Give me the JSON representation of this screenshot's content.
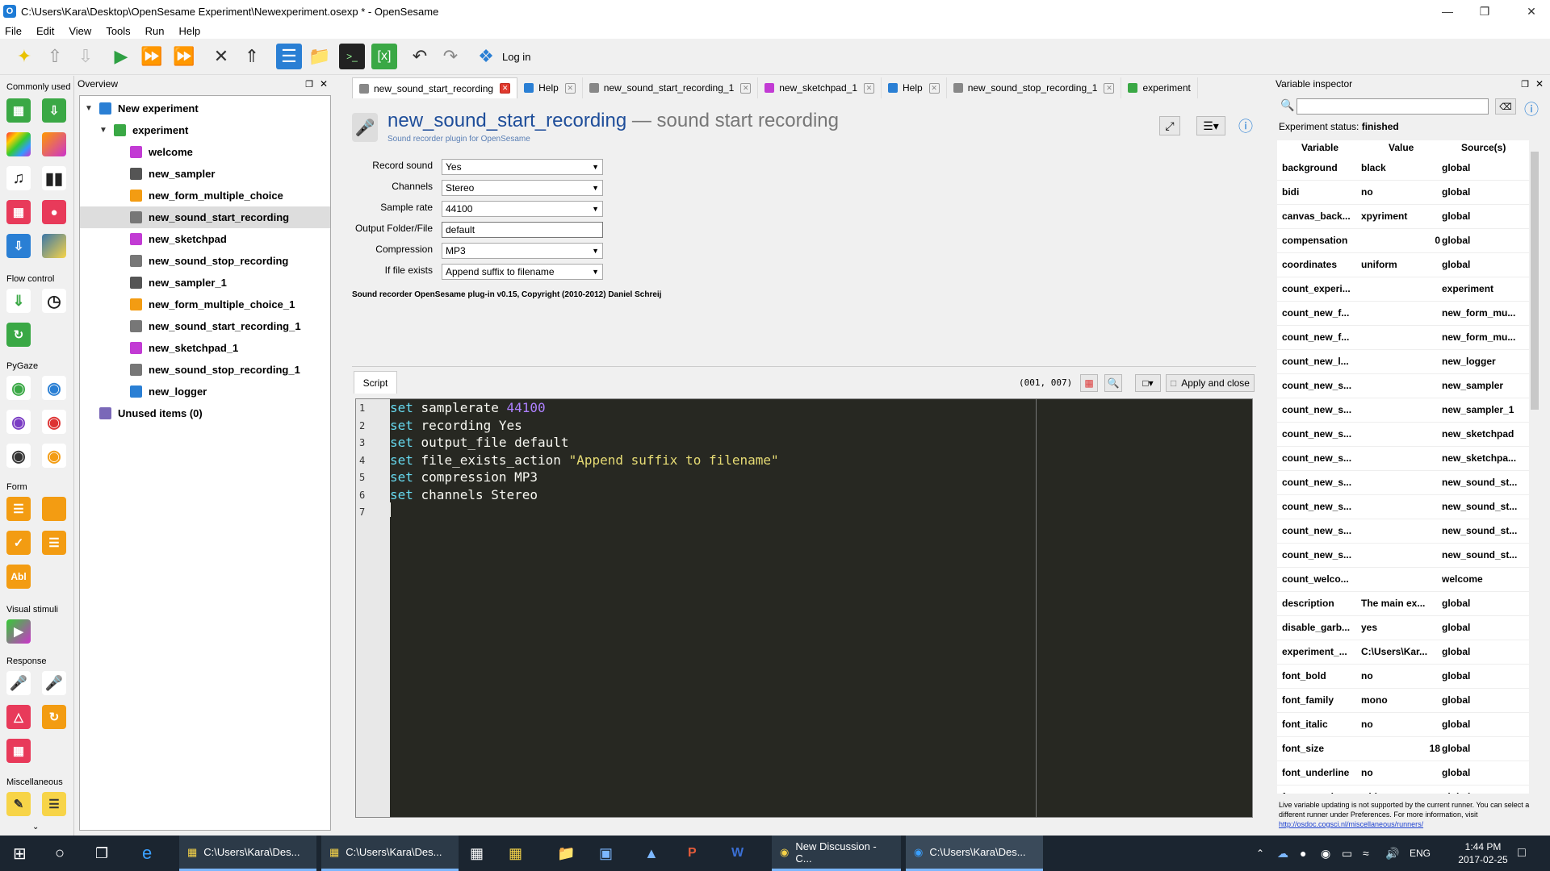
{
  "window": {
    "title": "C:\\Users\\Kara\\Desktop\\OpenSesame Experiment\\Newexperiment.osexp * - OpenSesame",
    "app_icon_letter": "O"
  },
  "menu": [
    "File",
    "Edit",
    "View",
    "Tools",
    "Run",
    "Help"
  ],
  "toolbar": {
    "login_label": "Log in"
  },
  "palette": {
    "sections": [
      "Commonly used",
      "Flow control",
      "PyGaze",
      "Form",
      "Visual stimuli",
      "Response",
      "Miscellaneous"
    ],
    "form_text_icon": "Abl"
  },
  "overview": {
    "title": "Overview",
    "root": "New experiment",
    "sequence": "experiment",
    "items": [
      {
        "name": "welcome",
        "color": "#c23bd4"
      },
      {
        "name": "new_sampler",
        "color": "#555555"
      },
      {
        "name": "new_form_multiple_choice",
        "color": "#f39c12"
      },
      {
        "name": "new_sound_start_recording",
        "color": "#777777"
      },
      {
        "name": "new_sketchpad",
        "color": "#c23bd4"
      },
      {
        "name": "new_sound_stop_recording",
        "color": "#777777"
      },
      {
        "name": "new_sampler_1",
        "color": "#555555"
      },
      {
        "name": "new_form_multiple_choice_1",
        "color": "#f39c12"
      },
      {
        "name": "new_sound_start_recording_1",
        "color": "#777777"
      },
      {
        "name": "new_sketchpad_1",
        "color": "#c23bd4"
      },
      {
        "name": "new_sound_stop_recording_1",
        "color": "#777777"
      },
      {
        "name": "new_logger",
        "color": "#2a7fd4"
      }
    ],
    "unused": "Unused items (0)"
  },
  "tabs": [
    {
      "label": "new_sound_start_recording",
      "active": true
    },
    {
      "label": "Help"
    },
    {
      "label": "new_sound_start_recording_1"
    },
    {
      "label": "new_sketchpad_1"
    },
    {
      "label": "Help"
    },
    {
      "label": "new_sound_stop_recording_1"
    },
    {
      "label": "experiment"
    }
  ],
  "item": {
    "name": "new_sound_start_recording",
    "type": "— sound start recording",
    "description": "Sound recorder plugin for OpenSesame"
  },
  "form": {
    "record_sound": {
      "label": "Record sound",
      "value": "Yes"
    },
    "channels": {
      "label": "Channels",
      "value": "Stereo"
    },
    "sample_rate": {
      "label": "Sample rate",
      "value": "44100"
    },
    "output": {
      "label": "Output Folder/File",
      "value": "default"
    },
    "compression": {
      "label": "Compression",
      "value": "MP3"
    },
    "if_exists": {
      "label": "If file exists",
      "value": "Append suffix to filename"
    }
  },
  "plugin_copyright": "Sound recorder OpenSesame plug-in v0.15, Copyright (2010-2012) Daniel Schreij",
  "script": {
    "tab_label": "Script",
    "cursor": "(001, 007)",
    "apply_label": "Apply and close",
    "lines": [
      {
        "kw": "set",
        "rest": " samplerate ",
        "val": "44100",
        "cls": "num"
      },
      {
        "kw": "set",
        "rest": " recording Yes",
        "val": "",
        "cls": ""
      },
      {
        "kw": "set",
        "rest": " output_file default",
        "val": "",
        "cls": ""
      },
      {
        "kw": "set",
        "rest": " file_exists_action ",
        "val": "\"Append suffix to filename\"",
        "cls": "str"
      },
      {
        "kw": "set",
        "rest": " compression MP3",
        "val": "",
        "cls": ""
      },
      {
        "kw": "set",
        "rest": " channels Stereo",
        "val": "",
        "cls": ""
      },
      {
        "kw": "",
        "rest": "",
        "val": "",
        "cls": ""
      }
    ]
  },
  "inspector": {
    "title": "Variable inspector",
    "status_label": "Experiment status:",
    "status_value": "finished",
    "headers": [
      "Variable",
      "Value",
      "Source(s)"
    ],
    "rows": [
      [
        "background",
        "black",
        "global"
      ],
      [
        "bidi",
        "no",
        "global"
      ],
      [
        "canvas_back...",
        "xpyriment",
        "global"
      ],
      [
        "compensation",
        "0",
        "global"
      ],
      [
        "coordinates",
        "uniform",
        "global"
      ],
      [
        "count_experi...",
        "",
        "experiment"
      ],
      [
        "count_new_f...",
        "",
        "new_form_mu..."
      ],
      [
        "count_new_f...",
        "",
        "new_form_mu..."
      ],
      [
        "count_new_l...",
        "",
        "new_logger"
      ],
      [
        "count_new_s...",
        "",
        "new_sampler"
      ],
      [
        "count_new_s...",
        "",
        "new_sampler_1"
      ],
      [
        "count_new_s...",
        "",
        "new_sketchpad"
      ],
      [
        "count_new_s...",
        "",
        "new_sketchpa..."
      ],
      [
        "count_new_s...",
        "",
        "new_sound_st..."
      ],
      [
        "count_new_s...",
        "",
        "new_sound_st..."
      ],
      [
        "count_new_s...",
        "",
        "new_sound_st..."
      ],
      [
        "count_new_s...",
        "",
        "new_sound_st..."
      ],
      [
        "count_welco...",
        "",
        "welcome"
      ],
      [
        "description",
        "The main ex...",
        "global"
      ],
      [
        "disable_garb...",
        "yes",
        "global"
      ],
      [
        "experiment_...",
        "C:\\Users\\Kar...",
        "global"
      ],
      [
        "font_bold",
        "no",
        "global"
      ],
      [
        "font_family",
        "mono",
        "global"
      ],
      [
        "font_italic",
        "no",
        "global"
      ],
      [
        "font_size",
        "18",
        "global"
      ],
      [
        "font_underline",
        "no",
        "global"
      ],
      [
        "foreground",
        "white",
        "global"
      ]
    ],
    "note": "Live variable updating is not supported by the current runner. You can select a different runner under Preferences. For more information, visit",
    "note_link": "http://osdoc.cogsci.nl/miscellaneous/runners/"
  },
  "taskbar": {
    "apps": [
      {
        "label": "C:\\Users\\Kara\\Des..."
      },
      {
        "label": "C:\\Users\\Kara\\Des..."
      },
      {
        "label": "New Discussion - C..."
      },
      {
        "label": "C:\\Users\\Kara\\Des..."
      }
    ],
    "lang": "ENG",
    "time": "1:44 PM",
    "date": "2017-02-25"
  }
}
